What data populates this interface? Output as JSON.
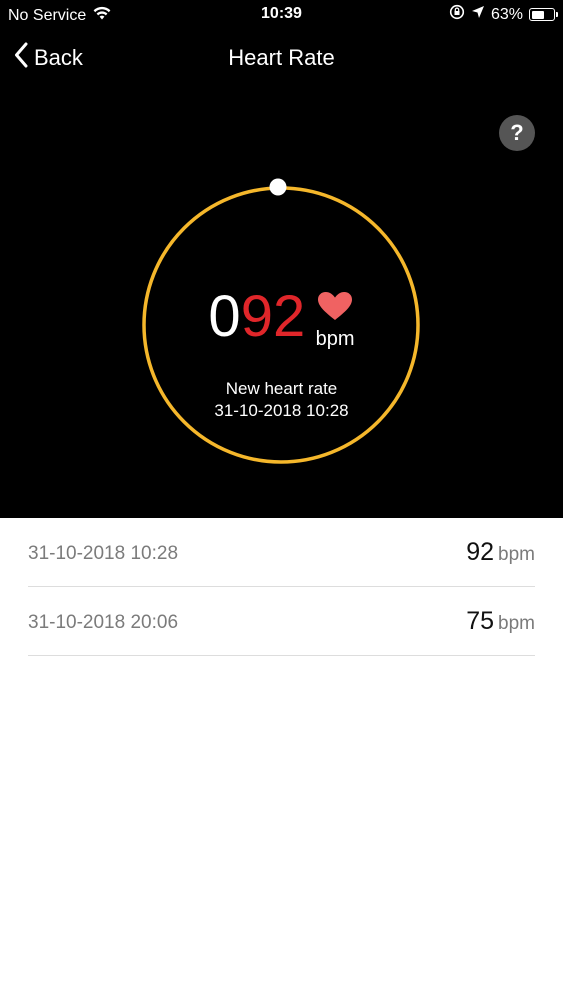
{
  "status_bar": {
    "carrier": "No Service",
    "time": "10:39",
    "battery_percent": "63%",
    "battery_level": 0.63
  },
  "nav": {
    "back_label": "Back",
    "title": "Heart Rate"
  },
  "help": {
    "label": "?"
  },
  "current": {
    "leading_digit": "0",
    "value": "92",
    "unit": "bpm",
    "caption_line1": "New heart rate",
    "caption_line2": "31-10-2018 10:28"
  },
  "history": [
    {
      "date": "31-10-2018 10:28",
      "value": "92",
      "unit": "bpm"
    },
    {
      "date": "31-10-2018 20:06",
      "value": "75",
      "unit": "bpm"
    }
  ],
  "colors": {
    "ring": "#f5b72b",
    "value_red": "#e0262a",
    "heart": "#f06262"
  },
  "icons": [
    "wifi-icon",
    "lock-rotation-icon",
    "location-icon",
    "battery-icon",
    "back-chevron-icon",
    "help-icon",
    "heart-icon"
  ]
}
